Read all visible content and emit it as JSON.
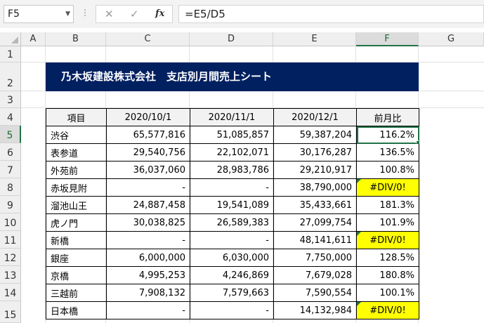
{
  "formula_bar": {
    "name_box": "F5",
    "dots": "⋮",
    "cancel": "✕",
    "enter": "✓",
    "fx": "fx",
    "formula": "=E5/D5"
  },
  "columns": [
    "A",
    "B",
    "C",
    "D",
    "E",
    "F",
    "G"
  ],
  "rows": [
    "1",
    "2",
    "3",
    "4",
    "5",
    "6",
    "7",
    "8",
    "9",
    "10",
    "11",
    "12",
    "13",
    "14",
    "15"
  ],
  "banner": {
    "title": "乃木坂建設株式会社　支店別月間売上シート"
  },
  "table": {
    "headers": [
      "項目",
      "2020/10/1",
      "2020/11/1",
      "2020/12/1",
      "前月比"
    ],
    "rows": [
      [
        "渋谷",
        "65,577,816",
        "51,085,857",
        "59,387,204",
        "116.2%"
      ],
      [
        "表参道",
        "29,540,756",
        "22,102,071",
        "30,176,287",
        "136.5%"
      ],
      [
        "外苑前",
        "36,037,060",
        "28,983,786",
        "29,210,917",
        "100.8%"
      ],
      [
        "赤坂見附",
        "-",
        "-",
        "38,790,000",
        "#DIV/0!"
      ],
      [
        "溜池山王",
        "24,887,458",
        "19,541,089",
        "35,433,661",
        "181.3%"
      ],
      [
        "虎ノ門",
        "30,038,825",
        "26,589,383",
        "27,099,754",
        "101.9%"
      ],
      [
        "新橋",
        "-",
        "-",
        "48,141,611",
        "#DIV/0!"
      ],
      [
        "銀座",
        "6,000,000",
        "6,030,000",
        "7,750,000",
        "128.5%"
      ],
      [
        "京橋",
        "4,995,253",
        "4,246,869",
        "7,679,028",
        "180.8%"
      ],
      [
        "三越前",
        "7,908,132",
        "7,579,663",
        "7,590,554",
        "100.1%"
      ],
      [
        "日本橋",
        "-",
        "-",
        "14,132,984",
        "#DIV/0!"
      ]
    ]
  },
  "colors": {
    "accent": "#217346",
    "banner": "#002060",
    "error_fill": "#ffff00"
  }
}
